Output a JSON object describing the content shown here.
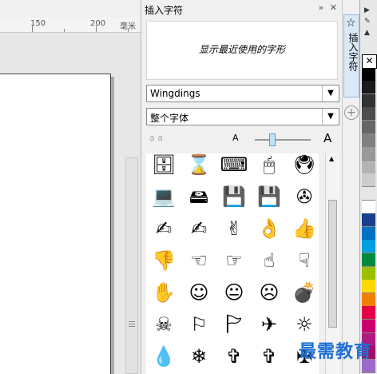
{
  "ruler": {
    "labels": [
      "150",
      "200",
      "毫米"
    ]
  },
  "docker": {
    "title": "插入字符",
    "recent_placeholder": "显示最近使用的字形",
    "font_select": "Wingdings",
    "subset_select": "整个字体",
    "zoom_small_label": "A",
    "zoom_large_label": "A",
    "zoom_level": 0.25
  },
  "glyphs": [
    [
      "🗄",
      "⌛",
      "⌨",
      "🖱",
      "🖲"
    ],
    [
      "💻",
      "🖴",
      "💾",
      "💾",
      "✇"
    ],
    [
      "✍",
      "✍",
      "✌",
      "👌",
      "👍"
    ],
    [
      "👎",
      "☜",
      "☞",
      "☝",
      "☟"
    ],
    [
      "✋",
      "☺",
      "😐",
      "☹",
      "💣"
    ],
    [
      "☠",
      "⚐",
      "🏱",
      "✈",
      "☼"
    ],
    [
      "💧",
      "❄",
      "✞",
      "✞",
      "✠"
    ]
  ],
  "tabs": {
    "insert_label": "插入字符"
  },
  "palette": {
    "colors": [
      "#ffffff",
      "#000000",
      "#1a1a1a",
      "#333333",
      "#4d4d4d",
      "#666666",
      "#808080",
      "#999999",
      "#b3b3b3",
      "#cccccc",
      "#e6e6e6",
      "#ffffff",
      "#1c3e8f",
      "#0070c0",
      "#00a0e0",
      "#008a3c",
      "#9ac000",
      "#ffd800",
      "#f08000",
      "#e40046",
      "#c8006e",
      "#b01a80",
      "#a0106a",
      "#9c6ac8"
    ]
  },
  "watermark": "最需教育"
}
